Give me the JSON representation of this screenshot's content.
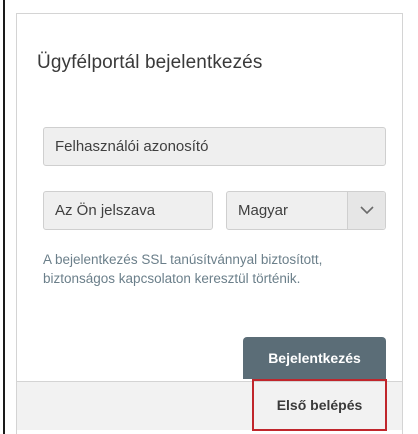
{
  "login": {
    "title": "Ügyfélportál bejelentkezés",
    "username_placeholder": "Felhasználói azonosító",
    "password_placeholder": "Az Ön jelszava",
    "language_selected": "Magyar",
    "info_text": "A bejelentkezés SSL tanúsítvánnyal biztosított, biztonságos kapcsolaton keresztül történik.",
    "login_button": "Bejelentkezés",
    "first_login_button": "Első belépés"
  },
  "colors": {
    "primary_button": "#5b6d77",
    "info_text": "#6b7f8a",
    "highlight_border": "#c0262c"
  },
  "icons": {
    "language_dropdown": "chevron-down-icon"
  }
}
